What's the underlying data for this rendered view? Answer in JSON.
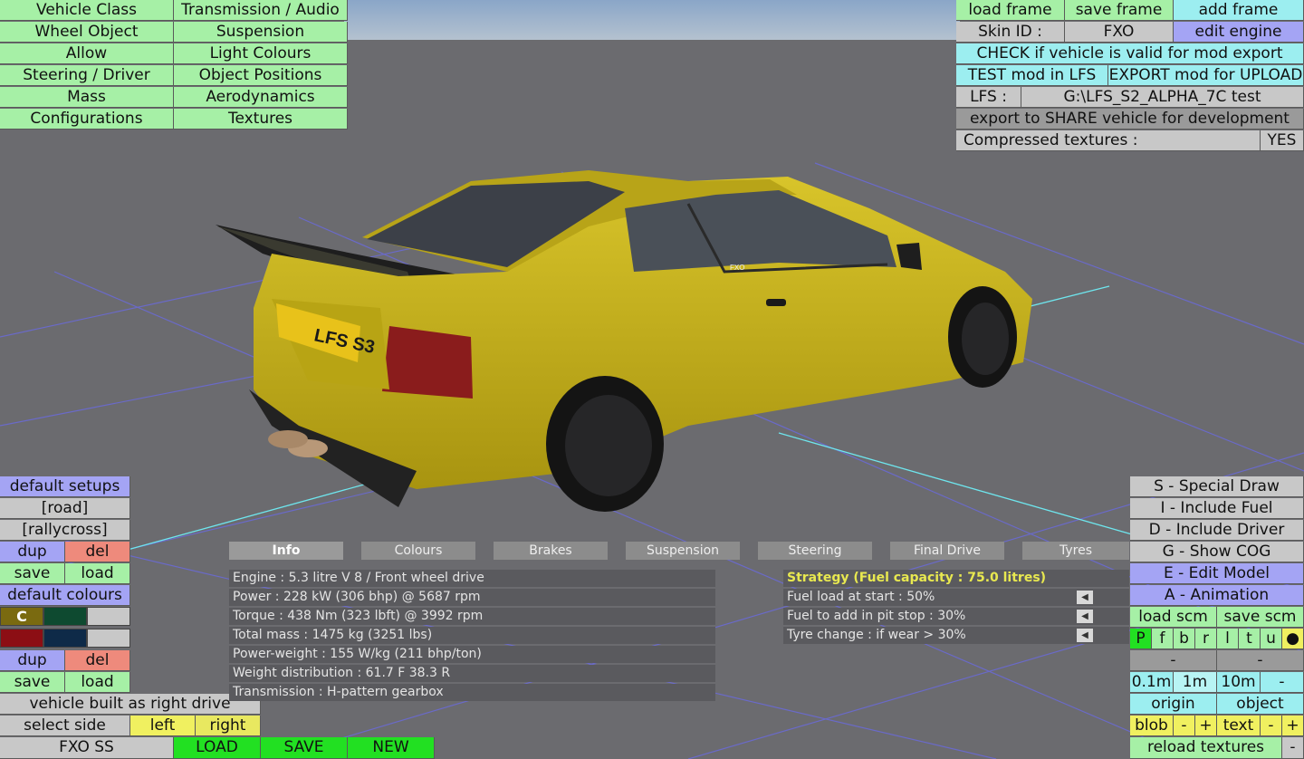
{
  "menu": {
    "left_col": [
      "Vehicle Class",
      "Wheel Object",
      "Allow",
      "Steering / Driver",
      "Mass",
      "Configurations"
    ],
    "right_col": [
      "Transmission / Audio",
      "Suspension",
      "Light Colours",
      "Object Positions",
      "Aerodynamics",
      "Textures"
    ]
  },
  "topright": {
    "load_frame": "load frame",
    "save_frame": "save frame",
    "add_frame": "add frame",
    "skin_id_label": "Skin ID :",
    "skin_id_value": "FXO",
    "edit_engine": "edit engine",
    "check_valid": "CHECK if vehicle is valid for mod export",
    "test_mod": "TEST mod in LFS",
    "export_mod": "EXPORT mod for UPLOAD",
    "lfs_label": "LFS :",
    "lfs_path": "G:\\LFS_S2_ALPHA_7C test",
    "export_share": "export to SHARE vehicle for development",
    "compressed_label": "Compressed textures :",
    "compressed_value": "YES"
  },
  "plate": "LFS S3",
  "badge": "FXO",
  "leftpanel": {
    "default_setups": "default setups",
    "road": "[road]",
    "rallycross": "[rallycross]",
    "dup": "dup",
    "del": "del",
    "save": "save",
    "load": "load",
    "default_colours": "default colours",
    "colour_c": "C",
    "right_drive": "vehicle built as right drive",
    "select_side": "select side",
    "left": "left",
    "right": "right"
  },
  "colors": {
    "swatch1": "#7a6a10",
    "swatch2": "#0e4a30",
    "swatch3": "#8c0e14",
    "swatch4": "#0e2a48",
    "car_body": "#c8b418"
  },
  "bottombar": {
    "vehicle": "FXO SS",
    "load": "LOAD",
    "save": "SAVE",
    "new": "NEW"
  },
  "tabs": [
    "Info",
    "Colours",
    "Brakes",
    "Suspension",
    "Steering",
    "Final Drive",
    "Tyres"
  ],
  "info_lines": [
    "Engine : 5.3 litre V 8 / Front wheel drive",
    "Power : 228 kW (306 bhp) @ 5687 rpm",
    "Torque : 438 Nm (323 lbft) @ 3992 rpm",
    "Total mass : 1475 kg (3251 lbs)",
    "Power-weight : 155 W/kg (211 bhp/ton)",
    "Weight distribution : 61.7 F  38.3 R",
    "Transmission : H-pattern gearbox"
  ],
  "strategy": {
    "title": "Strategy (Fuel capacity : 75.0 litres)",
    "lines": [
      "Fuel load at start : 50%",
      "Fuel to add in pit stop : 30%",
      "Tyre change : if wear > 30%"
    ]
  },
  "rightpanel": {
    "special_draw": "S - Special Draw",
    "include_fuel": "I - Include Fuel",
    "include_driver": "D - Include Driver",
    "show_cog": "G - Show COG",
    "edit_model": "E - Edit Model",
    "animation": "A - Animation",
    "load_scm": "load scm",
    "save_scm": "save scm",
    "letters": [
      "P",
      "f",
      "b",
      "r",
      "l",
      "t",
      "u",
      "●"
    ],
    "dash1": "-",
    "dash2": "-",
    "step_01": "0.1m",
    "step_1": "1m",
    "step_10": "10m",
    "step_minus": "-",
    "origin": "origin",
    "object": "object",
    "blob": "blob",
    "minus": "-",
    "plus": "+",
    "text": "text",
    "reload_textures": "reload textures",
    "reload_minus": "-"
  }
}
